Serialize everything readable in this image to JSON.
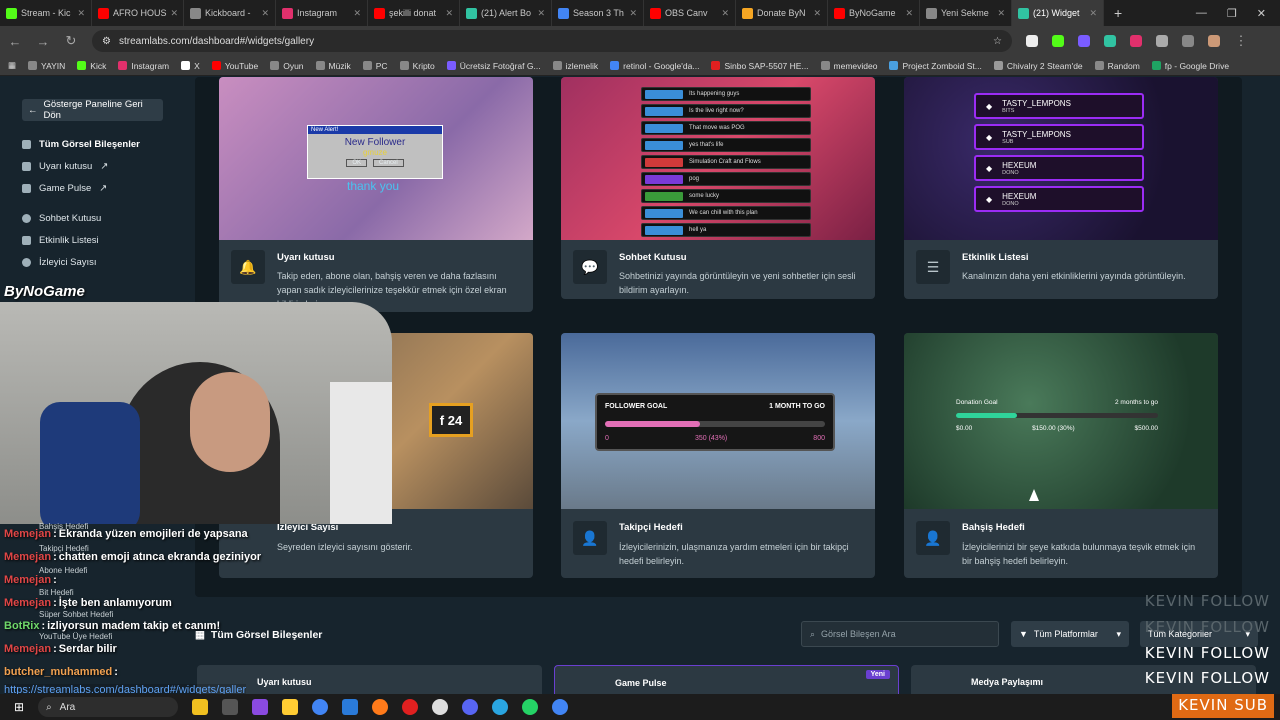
{
  "browser": {
    "tabs": [
      {
        "label": "Stream - Kic",
        "color": "#53fc18"
      },
      {
        "label": "AFRO HOUS",
        "color": "#ff0000"
      },
      {
        "label": "Kickboard -",
        "color": "#888888"
      },
      {
        "label": "Instagram",
        "color": "#e1306c"
      },
      {
        "label": "şekilli donat",
        "color": "#ff0000"
      },
      {
        "label": "(21) Alert Bo",
        "color": "#31c3a2"
      },
      {
        "label": "Season 3 Th",
        "color": "#4285f4"
      },
      {
        "label": "OBS Canv",
        "color": "#ff0000"
      },
      {
        "label": "Donate ByN",
        "color": "#f6a623"
      },
      {
        "label": "ByNoGame",
        "color": "#ff0000"
      },
      {
        "label": "Yeni Sekme",
        "color": "#888888"
      },
      {
        "label": "(21) Widget",
        "color": "#31c3a2"
      }
    ],
    "url": "streamlabs.com/dashboard#/widgets/gallery",
    "bookmarks": [
      "YAYIN",
      "Kick",
      "Instagram",
      "X",
      "YouTube",
      "Oyun",
      "Müzik",
      "PC",
      "Kripto",
      "Ücretsiz Fotoğraf G...",
      "izlemelik",
      "retinol - Google'da...",
      "Sinbo SAP-5507 HE...",
      "memevideo",
      "Project Zomboid St...",
      "Chivalry 2 Steam'de",
      "Random",
      "fp - Google Drive"
    ]
  },
  "sidebar": {
    "back_label": "Gösterge Paneline Geri Dön",
    "items": [
      {
        "label": "Tüm Görsel Bileşenler",
        "bold": true
      },
      {
        "label": "Uyarı kutusu",
        "bold": false
      },
      {
        "label": "Game Pulse",
        "bold": false
      },
      {
        "label": "Sohbet Kutusu",
        "bold": false
      },
      {
        "label": "Etkinlik Listesi",
        "bold": false
      },
      {
        "label": "İzleyici Sayısı",
        "bold": false
      }
    ]
  },
  "cards": [
    {
      "title": "Uyarı kutusu",
      "desc": "Takip eden, abone olan, bahşiş veren ve daha fazlasını yapan sadık izleyicilerinize teşekkür etmek için özel ekran bildirimleri."
    },
    {
      "title": "Sohbet Kutusu",
      "desc": "Sohbetinizi yayında görüntüleyin ve yeni sohbetler için sesli bildirim ayarlayın."
    },
    {
      "title": "Etkinlik Listesi",
      "desc": "Kanalınızın daha yeni etkinliklerini yayında görüntüleyin."
    },
    {
      "title": "İzleyici Sayısı",
      "desc": "Seyreden izleyici sayısını gösterir."
    },
    {
      "title": "Takipçi Hedefi",
      "desc": "İzleyicilerinizin, ulaşmanıza yardım etmeleri için bir takipçi hedefi belirleyin."
    },
    {
      "title": "Bahşiş Hedefi",
      "desc": "İzleyicilerinizi bir şeye katkıda bulunmaya teşvik etmek için bir bahşiş hedefi belirleyin."
    }
  ],
  "alert_preview": {
    "title": "New Alert!",
    "line1": "New Follower",
    "name": "gmuze",
    "ok": "OK",
    "cancel": "Cancel",
    "thanks": "thank you"
  },
  "events": [
    {
      "name": "TASTY_LEMPONS",
      "type": "BITS"
    },
    {
      "name": "TASTY_LEMPONS",
      "type": "SUB"
    },
    {
      "name": "HEXEUM",
      "type": "DONO"
    },
    {
      "name": "HEXEUM",
      "type": "DONO"
    }
  ],
  "follower_goal": {
    "title": "FOLLOWER GOAL",
    "remaining": "1 MONTH TO GO",
    "start": "0",
    "current": "350 (43%)",
    "target": "800",
    "progress": 0.43
  },
  "donation_goal": {
    "title": "Donation Goal",
    "remaining": "2 months to go",
    "start": "$0.00",
    "current": "$150.00 (30%)",
    "target": "$500.00",
    "progress": 0.3
  },
  "viewer_badge": "24",
  "toolbar": {
    "section_title": "Tüm Görsel Bileşenler",
    "search_placeholder": "Görsel Bileşen Ara",
    "platforms": "Tüm Platformlar",
    "categories": "Tüm Kategoriler"
  },
  "bottom_cards": [
    {
      "label": "Uyarı kutusu",
      "badge": ""
    },
    {
      "label": "Game Pulse",
      "badge": "Yeni"
    },
    {
      "label": "Medya Paylaşımı",
      "badge": ""
    }
  ],
  "overlay": {
    "logo": "ByNoGame",
    "chat": [
      {
        "user": "Memejan",
        "msg": "Ekranda yüzen emojileri de yapsana",
        "color": "red"
      },
      {
        "user": "Memejan",
        "msg": "chatten emoji atınca ekranda geziniyor",
        "color": "red"
      },
      {
        "user": "Memejan",
        "msg": "",
        "color": "red"
      },
      {
        "user": "Memejan",
        "msg": "İşte ben anlamıyorum",
        "color": "red"
      },
      {
        "user": "BotRix",
        "msg": "izliyorsun madem takip et canım!",
        "color": "green"
      },
      {
        "user": "Memejan",
        "msg": "Serdar bilir",
        "color": "red"
      },
      {
        "user": "butcher_muhammed",
        "msg": "",
        "color": "orange"
      }
    ],
    "ghost_items": [
      "Bahşiş Hedefi",
      "Takipçi Hedefi",
      "Abone Hedefi",
      "Bit Hedefi",
      "Süper Sohbet Hedefi",
      "YouTube Üye Hedefi"
    ],
    "status_url": "https://streamlabs.com/dashboard#/widgets/galler",
    "follow_lines": [
      "KEVIN FOLLOW",
      "KEVIN FOLLOW",
      "KEVIN FOLLOW",
      "KEVIN FOLLOW"
    ],
    "sub_label": "KEVIN SUB"
  },
  "taskbar": {
    "search_label": "Ara"
  }
}
